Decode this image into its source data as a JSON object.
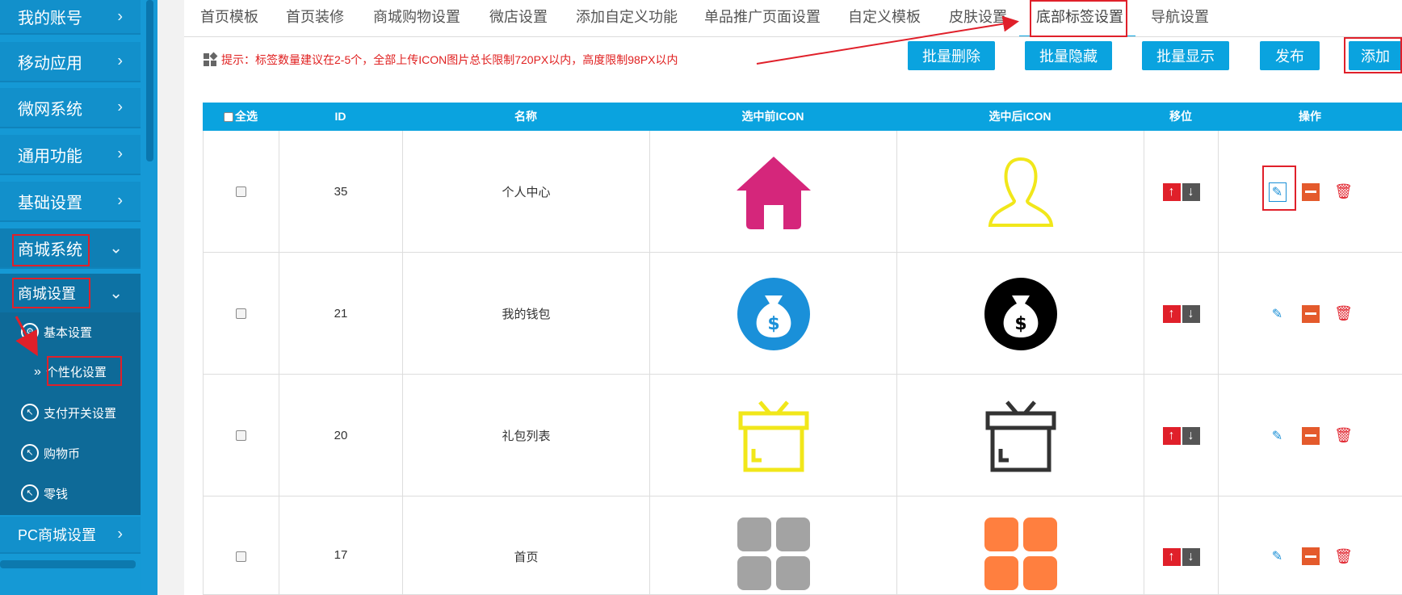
{
  "sidebar": {
    "items": [
      {
        "label": "我的账号"
      },
      {
        "label": "移动应用"
      },
      {
        "label": "微网系统"
      },
      {
        "label": "通用功能"
      },
      {
        "label": "基础设置"
      },
      {
        "label": "商城系统"
      },
      {
        "label": "商城设置"
      },
      {
        "label": "PC商城设置"
      }
    ],
    "submenu": [
      {
        "label": "基本设置",
        "icon": "gear-icon"
      },
      {
        "label": "个性化设置",
        "icon": "double-chevron-icon"
      },
      {
        "label": "支付开关设置",
        "icon": "circle-arrow-icon"
      },
      {
        "label": "购物币",
        "icon": "circle-arrow-icon"
      },
      {
        "label": "零钱",
        "icon": "circle-arrow-icon"
      }
    ]
  },
  "tabs": [
    "首页模板",
    "首页装修",
    "商城购物设置",
    "微店设置",
    "添加自定义功能",
    "单品推广页面设置",
    "自定义模板",
    "皮肤设置",
    "底部标签设置",
    "导航设置"
  ],
  "tip": "提示：标签数量建议在2-5个，全部上传ICON图片总长限制720PX以内，高度限制98PX以内",
  "buttons": {
    "batch_delete": "批量删除",
    "batch_hide": "批量隐藏",
    "batch_show": "批量显示",
    "publish": "发布",
    "add": "添加"
  },
  "table": {
    "headers": [
      "全选",
      "ID",
      "名称",
      "选中前ICON",
      "选中后ICON",
      "移位",
      "操作"
    ],
    "rows": [
      {
        "id": "35",
        "name": "个人中心",
        "icon_before": "house-icon",
        "icon_after": "person-outline-icon"
      },
      {
        "id": "21",
        "name": "我的钱包",
        "icon_before": "money-bag-blue-icon",
        "icon_after": "money-bag-black-icon"
      },
      {
        "id": "20",
        "name": "礼包列表",
        "icon_before": "gift-box-yellow-icon",
        "icon_after": "gift-box-dark-icon"
      },
      {
        "id": "17",
        "name": "首页",
        "icon_before": "grid-gray-icon",
        "icon_after": "grid-orange-icon"
      }
    ]
  },
  "colors": {
    "accent": "#0aa3df",
    "highlight": "#e0202a",
    "sidebar": "#1599d5"
  }
}
